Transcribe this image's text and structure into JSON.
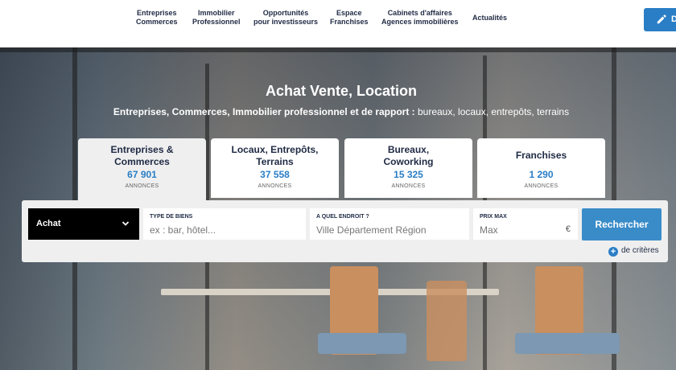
{
  "nav": {
    "items": [
      {
        "line1": "Entreprises",
        "line2": "Commerces"
      },
      {
        "line1": "Immobilier",
        "line2": "Professionnel"
      },
      {
        "line1": "Opportunités",
        "line2": "pour investisseurs"
      },
      {
        "line1": "Espace",
        "line2": "Franchises"
      },
      {
        "line1": "Cabinets d'affaires",
        "line2": "Agences immobilières"
      },
      {
        "line1": "Actualités",
        "line2": ""
      }
    ],
    "deposer_label": "D"
  },
  "hero": {
    "title": "Achat Vente, Location",
    "subtitle_bold": "Entreprises, Commerces, Immobilier professionnel et de rapport :",
    "subtitle_rest": " bureaux, locaux, entrepôts, terrains"
  },
  "categories": [
    {
      "name": "Entreprises & Commerces",
      "count": "67 901",
      "unit": "ANNONCES",
      "active": true
    },
    {
      "name": "Locaux, Entrepôts, Terrains",
      "count": "37 558",
      "unit": "ANNONCES",
      "active": false
    },
    {
      "name": "Bureaux, Coworking",
      "count": "15 325",
      "unit": "ANNONCES",
      "active": false
    },
    {
      "name": "Franchises",
      "count": "1 290",
      "unit": "ANNONCES",
      "active": false
    }
  ],
  "search": {
    "transaction_value": "Achat",
    "type_label": "TYPE DE BIENS",
    "type_placeholder": "ex : bar, hôtel...",
    "where_label": "A QUEL ENDROIT ?",
    "where_placeholder": "Ville Département Région",
    "price_label": "PRIX MAX",
    "price_placeholder": "Max",
    "currency": "€",
    "submit_label": "Rechercher",
    "more_label": "de critères"
  },
  "colors": {
    "accent": "#2a7ec6",
    "navy": "#1f2a44"
  }
}
